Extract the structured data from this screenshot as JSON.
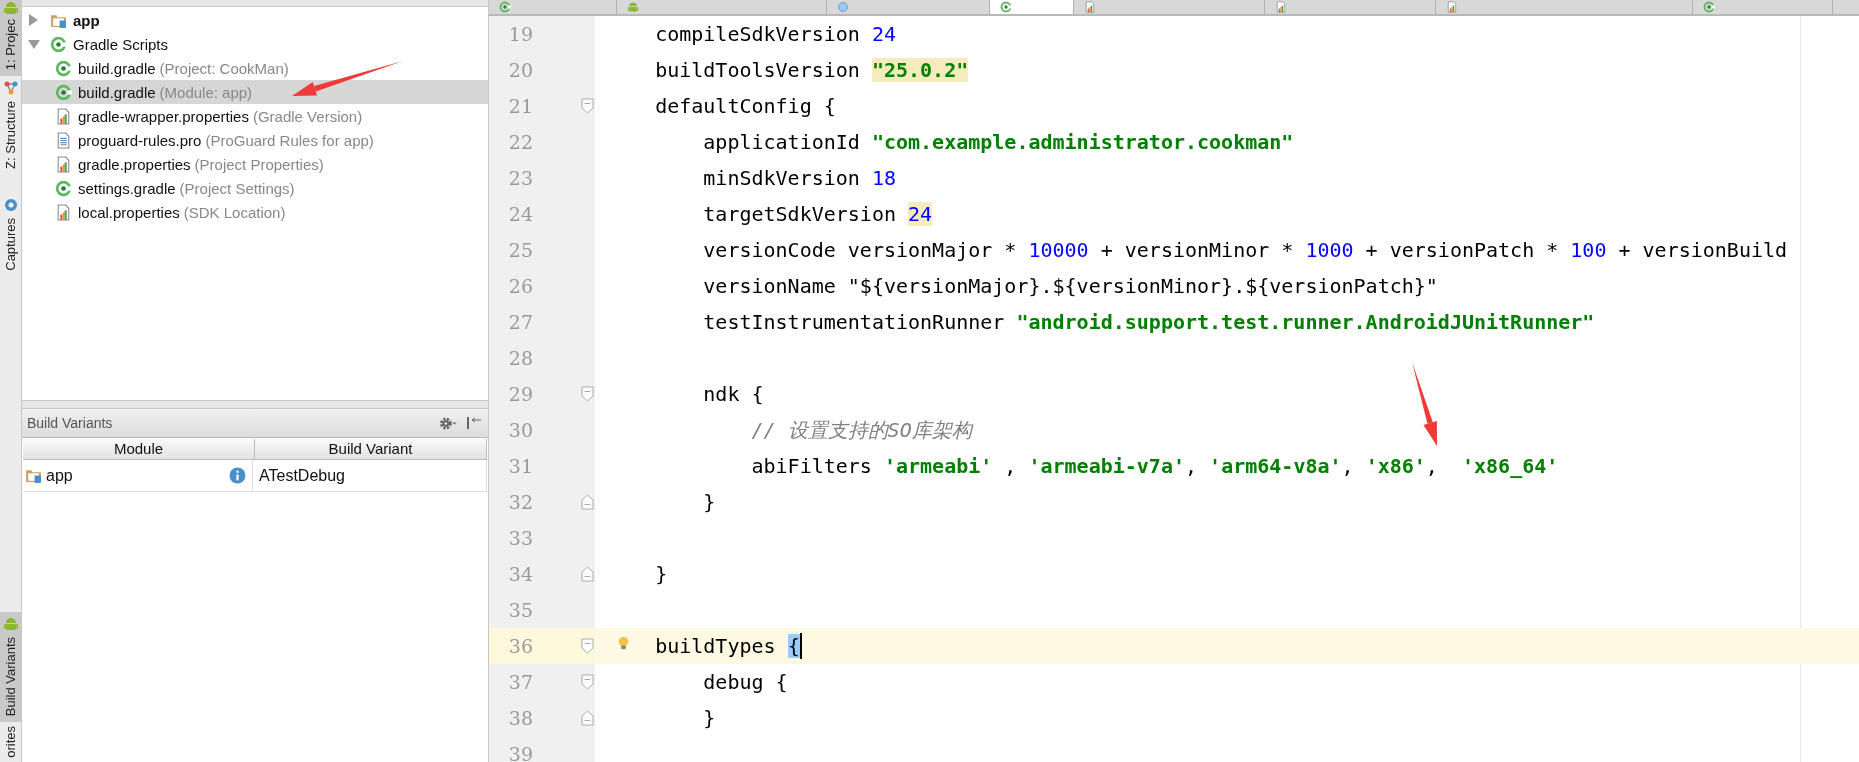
{
  "tool_strip": [
    {
      "label": "1: Projec",
      "kind": "android",
      "selected": true
    },
    {
      "label": "Z: Structure",
      "kind": "structure",
      "selected": false
    },
    {
      "label": "Captures",
      "kind": "capture",
      "selected": false
    },
    {
      "label": "Build Variants",
      "kind": "android",
      "selected": true
    },
    {
      "label": "orites",
      "kind": "plain",
      "selected": false
    }
  ],
  "project_tree": [
    {
      "label": "app",
      "kind": "module",
      "expanded": false,
      "selected": false
    },
    {
      "label": "Gradle Scripts",
      "kind": "gradle",
      "expanded": true,
      "selected": false,
      "children": [
        {
          "label": "build.gradle",
          "hint": "(Project: CookMan)",
          "kind": "gradle",
          "selected": false
        },
        {
          "label": "build.gradle",
          "hint": "(Module: app)",
          "kind": "gradle",
          "selected": true
        },
        {
          "label": "gradle-wrapper.properties",
          "hint": "(Gradle Version)",
          "kind": "properties",
          "selected": false
        },
        {
          "label": "proguard-rules.pro",
          "hint": "(ProGuard Rules for app)",
          "kind": "text",
          "selected": false
        },
        {
          "label": "gradle.properties",
          "hint": "(Project Properties)",
          "kind": "properties",
          "selected": false
        },
        {
          "label": "settings.gradle",
          "hint": "(Project Settings)",
          "kind": "gradle",
          "selected": false
        },
        {
          "label": "local.properties",
          "hint": "(SDK Location)",
          "kind": "properties",
          "selected": false
        }
      ]
    }
  ],
  "build_variants": {
    "title": "Build Variants",
    "columns": [
      "Module",
      "Build Variant"
    ],
    "rows": [
      {
        "module": "app",
        "variant": "ATestDebug"
      }
    ]
  },
  "editor_tabs": [
    {
      "kind": "gradle",
      "selected": false
    },
    {
      "kind": "android",
      "selected": false
    },
    {
      "kind": "circle",
      "selected": false
    },
    {
      "kind": "gradle",
      "selected": true
    },
    {
      "kind": "properties",
      "selected": false
    },
    {
      "kind": "properties",
      "selected": false
    },
    {
      "kind": "properties",
      "selected": false
    },
    {
      "kind": "gradle",
      "selected": false
    }
  ],
  "code_lines": [
    {
      "number": "19",
      "tokens": [
        {
          "kind": "plain",
          "text": "    compileSdkVersion "
        },
        {
          "kind": "number",
          "text": "24"
        }
      ]
    },
    {
      "number": "20",
      "tokens": [
        {
          "kind": "plain",
          "text": "    buildToolsVersion "
        },
        {
          "kind": "string",
          "text": "\"25.0.2\"",
          "highlighted": true
        }
      ]
    },
    {
      "number": "21",
      "fold_start": true,
      "tokens": [
        {
          "kind": "plain",
          "text": "    defaultConfig {"
        }
      ]
    },
    {
      "number": "22",
      "tokens": [
        {
          "kind": "plain",
          "text": "        applicationId "
        },
        {
          "kind": "string",
          "text": "\"com.example.administrator.cookman\""
        }
      ]
    },
    {
      "number": "23",
      "tokens": [
        {
          "kind": "plain",
          "text": "        minSdkVersion "
        },
        {
          "kind": "number",
          "text": "18"
        }
      ]
    },
    {
      "number": "24",
      "tokens": [
        {
          "kind": "plain",
          "text": "        targetSdkVersion "
        },
        {
          "kind": "number",
          "text": "24",
          "highlighted": true
        }
      ]
    },
    {
      "number": "25",
      "tokens": [
        {
          "kind": "plain",
          "text": "        versionCode versionMajor * "
        },
        {
          "kind": "number",
          "text": "10000"
        },
        {
          "kind": "plain",
          "text": " + versionMinor * "
        },
        {
          "kind": "number",
          "text": "1000"
        },
        {
          "kind": "plain",
          "text": " + versionPatch * "
        },
        {
          "kind": "number",
          "text": "100"
        },
        {
          "kind": "plain",
          "text": " + versionBuild"
        }
      ]
    },
    {
      "number": "26",
      "tokens": [
        {
          "kind": "plain",
          "text": "        versionName \"${versionMajor}.${versionMinor}.${versionPatch}\""
        }
      ]
    },
    {
      "number": "27",
      "tokens": [
        {
          "kind": "plain",
          "text": "        testInstrumentationRunner "
        },
        {
          "kind": "string",
          "text": "\"android.support.test.runner.AndroidJUnitRunner\""
        }
      ]
    },
    {
      "number": "28"
    },
    {
      "number": "29",
      "fold_start": true,
      "tokens": [
        {
          "kind": "plain",
          "text": "        ndk {"
        }
      ]
    },
    {
      "number": "30",
      "tokens": [
        {
          "kind": "comment",
          "text": "            // 设置支持的SO库架构"
        }
      ]
    },
    {
      "number": "31",
      "tokens": [
        {
          "kind": "plain",
          "text": "            abiFilters "
        },
        {
          "kind": "string",
          "text": "'armeabi'"
        },
        {
          "kind": "plain",
          "text": " , "
        },
        {
          "kind": "string",
          "text": "'armeabi-v7a'"
        },
        {
          "kind": "plain",
          "text": ", "
        },
        {
          "kind": "string",
          "text": "'arm64-v8a'"
        },
        {
          "kind": "plain",
          "text": ", "
        },
        {
          "kind": "string",
          "text": "'x86'"
        },
        {
          "kind": "plain",
          "text": ",  "
        },
        {
          "kind": "string",
          "text": "'x86_64'"
        }
      ]
    },
    {
      "number": "32",
      "fold_end": true,
      "tokens": [
        {
          "kind": "plain",
          "text": "        }"
        }
      ]
    },
    {
      "number": "33"
    },
    {
      "number": "34",
      "fold_end": true,
      "tokens": [
        {
          "kind": "plain",
          "text": "    }"
        }
      ]
    },
    {
      "number": "35"
    },
    {
      "number": "36",
      "fold_start": true,
      "current": true,
      "bulb": true,
      "tokens": [
        {
          "kind": "plain",
          "text": "    buildTypes "
        },
        {
          "kind": "plain",
          "text": "{",
          "matched": true,
          "caret": true
        }
      ]
    },
    {
      "number": "37",
      "fold_start": true,
      "tokens": [
        {
          "kind": "plain",
          "text": "        debug {"
        }
      ]
    },
    {
      "number": "38",
      "fold_end": true,
      "tokens": [
        {
          "kind": "plain",
          "text": "        }"
        }
      ]
    },
    {
      "number": "39"
    }
  ],
  "annotations": [
    {
      "kind": "arrow"
    },
    {
      "kind": "arrow"
    }
  ]
}
